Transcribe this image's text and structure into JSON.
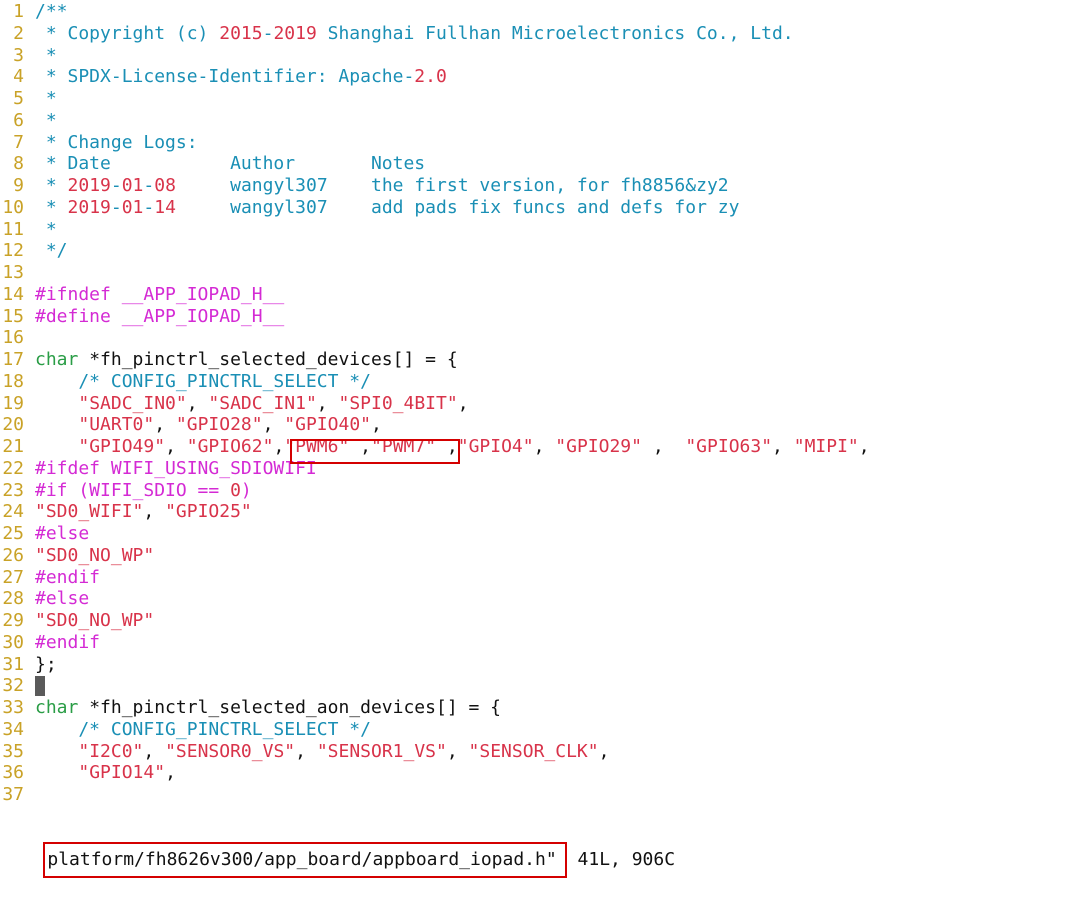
{
  "editor": {
    "lines": [
      {
        "n": "1",
        "segs": [
          {
            "t": "/**",
            "c": "cm"
          }
        ]
      },
      {
        "n": "2",
        "segs": [
          {
            "t": " * Copyright (c) ",
            "c": "cm"
          },
          {
            "t": "2015",
            "c": "nm"
          },
          {
            "t": "-",
            "c": "cm"
          },
          {
            "t": "2019",
            "c": "nm"
          },
          {
            "t": " Shanghai Fullhan Microelectronics Co., Ltd.",
            "c": "cm"
          }
        ]
      },
      {
        "n": "3",
        "segs": [
          {
            "t": " *",
            "c": "cm"
          }
        ]
      },
      {
        "n": "4",
        "segs": [
          {
            "t": " * SPDX-License-Identifier: Apache-",
            "c": "cm"
          },
          {
            "t": "2.0",
            "c": "nm"
          }
        ]
      },
      {
        "n": "5",
        "segs": [
          {
            "t": " *",
            "c": "cm"
          }
        ]
      },
      {
        "n": "6",
        "segs": [
          {
            "t": " *",
            "c": "cm"
          }
        ]
      },
      {
        "n": "7",
        "segs": [
          {
            "t": " * Change Logs:",
            "c": "cm"
          }
        ]
      },
      {
        "n": "8",
        "segs": [
          {
            "t": " * Date           Author       Notes",
            "c": "cm"
          }
        ]
      },
      {
        "n": "9",
        "segs": [
          {
            "t": " * ",
            "c": "cm"
          },
          {
            "t": "2019",
            "c": "nm"
          },
          {
            "t": "-",
            "c": "cm"
          },
          {
            "t": "01",
            "c": "nm"
          },
          {
            "t": "-",
            "c": "cm"
          },
          {
            "t": "08",
            "c": "nm"
          },
          {
            "t": "     wangyl307    the first version, for fh8856&zy2",
            "c": "cm"
          }
        ]
      },
      {
        "n": "10",
        "segs": [
          {
            "t": " * ",
            "c": "cm"
          },
          {
            "t": "2019",
            "c": "nm"
          },
          {
            "t": "-",
            "c": "cm"
          },
          {
            "t": "01",
            "c": "nm"
          },
          {
            "t": "-",
            "c": "cm"
          },
          {
            "t": "14",
            "c": "nm"
          },
          {
            "t": "     wangyl307    add pads fix funcs and defs for zy",
            "c": "cm"
          }
        ]
      },
      {
        "n": "11",
        "segs": [
          {
            "t": " *",
            "c": "cm"
          }
        ]
      },
      {
        "n": "12",
        "segs": [
          {
            "t": " */",
            "c": "cm"
          }
        ]
      },
      {
        "n": "13",
        "segs": []
      },
      {
        "n": "14",
        "segs": [
          {
            "t": "#ifndef __APP_IOPAD_H__",
            "c": "pp"
          }
        ]
      },
      {
        "n": "15",
        "segs": [
          {
            "t": "#define __APP_IOPAD_H__",
            "c": "pp"
          }
        ]
      },
      {
        "n": "16",
        "segs": []
      },
      {
        "n": "17",
        "segs": [
          {
            "t": "char",
            "c": "kw"
          },
          {
            "t": " *fh_pinctrl_selected_devices[] = {",
            "c": "id"
          }
        ]
      },
      {
        "n": "18",
        "segs": [
          {
            "t": "    /* CONFIG_PINCTRL_SELECT */",
            "c": "cm"
          }
        ]
      },
      {
        "n": "19",
        "segs": [
          {
            "t": "    ",
            "c": "id"
          },
          {
            "t": "\"SADC_IN0\"",
            "c": "st"
          },
          {
            "t": ", ",
            "c": "id"
          },
          {
            "t": "\"SADC_IN1\"",
            "c": "st"
          },
          {
            "t": ", ",
            "c": "id"
          },
          {
            "t": "\"SPI0_4BIT\"",
            "c": "st"
          },
          {
            "t": ",",
            "c": "id"
          }
        ]
      },
      {
        "n": "20",
        "segs": [
          {
            "t": "    ",
            "c": "id"
          },
          {
            "t": "\"UART0\"",
            "c": "st"
          },
          {
            "t": ", ",
            "c": "id"
          },
          {
            "t": "\"GPIO28\"",
            "c": "st"
          },
          {
            "t": ", ",
            "c": "id"
          },
          {
            "t": "\"GPIO40\"",
            "c": "st"
          },
          {
            "t": ",",
            "c": "id"
          }
        ]
      },
      {
        "n": "21",
        "segs": [
          {
            "t": "    ",
            "c": "id"
          },
          {
            "t": "\"GPIO49\"",
            "c": "st"
          },
          {
            "t": ", ",
            "c": "id"
          },
          {
            "t": "\"GPIO62\"",
            "c": "st"
          },
          {
            "t": ",",
            "c": "id"
          },
          {
            "t": "\"PWM6\"",
            "c": "st"
          },
          {
            "t": " ,",
            "c": "id"
          },
          {
            "t": "\"PWM7\"",
            "c": "st"
          },
          {
            "t": " ,",
            "c": "id"
          },
          {
            "t": "\"GPIO4\"",
            "c": "st"
          },
          {
            "t": ", ",
            "c": "id"
          },
          {
            "t": "\"GPIO29\"",
            "c": "st"
          },
          {
            "t": " ,  ",
            "c": "id"
          },
          {
            "t": "\"GPIO63\"",
            "c": "st"
          },
          {
            "t": ", ",
            "c": "id"
          },
          {
            "t": "\"MIPI\"",
            "c": "st"
          },
          {
            "t": ",",
            "c": "id"
          }
        ]
      },
      {
        "n": "22",
        "segs": [
          {
            "t": "#ifdef WIFI_USING_SDIOWIFI",
            "c": "pp"
          }
        ]
      },
      {
        "n": "23",
        "segs": [
          {
            "t": "#if (WIFI_SDIO == ",
            "c": "pp"
          },
          {
            "t": "0",
            "c": "nm"
          },
          {
            "t": ")",
            "c": "pp"
          }
        ]
      },
      {
        "n": "24",
        "segs": [
          {
            "t": "\"SD0_WIFI\"",
            "c": "st"
          },
          {
            "t": ", ",
            "c": "id"
          },
          {
            "t": "\"GPIO25\"",
            "c": "st"
          }
        ]
      },
      {
        "n": "25",
        "segs": [
          {
            "t": "#else",
            "c": "pp"
          }
        ]
      },
      {
        "n": "26",
        "segs": [
          {
            "t": "\"SD0_NO_WP\"",
            "c": "st"
          }
        ]
      },
      {
        "n": "27",
        "segs": [
          {
            "t": "#endif",
            "c": "pp"
          }
        ]
      },
      {
        "n": "28",
        "segs": [
          {
            "t": "#else",
            "c": "pp"
          }
        ]
      },
      {
        "n": "29",
        "segs": [
          {
            "t": "\"SD0_NO_WP\"",
            "c": "st"
          }
        ]
      },
      {
        "n": "30",
        "segs": [
          {
            "t": "#endif",
            "c": "pp"
          }
        ]
      },
      {
        "n": "31",
        "segs": [
          {
            "t": "};",
            "c": "id"
          }
        ]
      },
      {
        "n": "32",
        "segs": [],
        "cursor": true
      },
      {
        "n": "33",
        "segs": [
          {
            "t": "char",
            "c": "kw"
          },
          {
            "t": " *fh_pinctrl_selected_aon_devices[] = {",
            "c": "id"
          }
        ]
      },
      {
        "n": "34",
        "segs": [
          {
            "t": "    /* CONFIG_PINCTRL_SELECT */",
            "c": "cm"
          }
        ]
      },
      {
        "n": "35",
        "segs": [
          {
            "t": "    ",
            "c": "id"
          },
          {
            "t": "\"I2C0\"",
            "c": "st"
          },
          {
            "t": ", ",
            "c": "id"
          },
          {
            "t": "\"SENSOR0_VS\"",
            "c": "st"
          },
          {
            "t": ", ",
            "c": "id"
          },
          {
            "t": "\"SENSOR1_VS\"",
            "c": "st"
          },
          {
            "t": ", ",
            "c": "id"
          },
          {
            "t": "\"SENSOR_CLK\"",
            "c": "st"
          },
          {
            "t": ",",
            "c": "id"
          }
        ]
      },
      {
        "n": "36",
        "segs": [
          {
            "t": "    ",
            "c": "id"
          },
          {
            "t": "\"GPIO14\"",
            "c": "st"
          },
          {
            "t": ",",
            "c": "id"
          }
        ]
      },
      {
        "n": "37",
        "segs": []
      }
    ]
  },
  "statusbar": {
    "filename": "platform/fh8626v300/app_board/appboard_iopad.h\"",
    "info": " 41L, 906C"
  }
}
